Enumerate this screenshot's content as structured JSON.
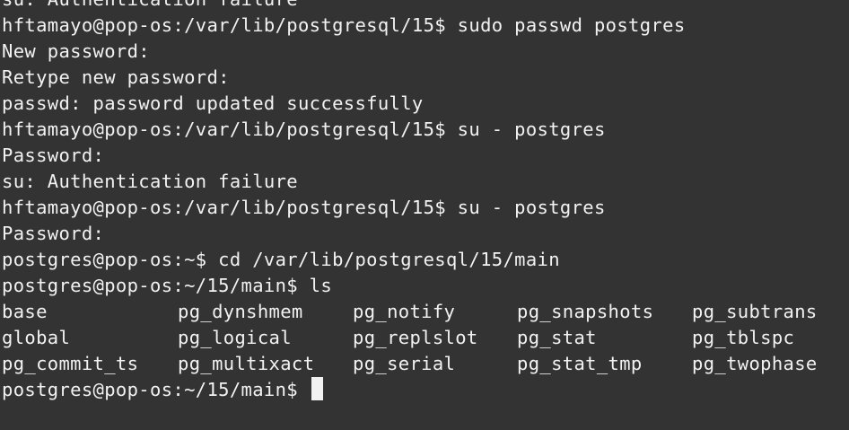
{
  "terminal": {
    "lines": [
      "su: Authentication failure",
      "hftamayo@pop-os:/var/lib/postgresql/15$ sudo passwd postgres",
      "New password:",
      "Retype new password:",
      "passwd: password updated successfully",
      "hftamayo@pop-os:/var/lib/postgresql/15$ su - postgres",
      "Password:",
      "su: Authentication failure",
      "hftamayo@pop-os:/var/lib/postgresql/15$ su - postgres",
      "Password:",
      "postgres@pop-os:~$ cd /var/lib/postgresql/15/main",
      "postgres@pop-os:~/15/main$ ls"
    ],
    "ls_rows": [
      [
        "base",
        "pg_dynshmem",
        "pg_notify",
        "pg_snapshots",
        "pg_subtrans"
      ],
      [
        "global",
        "pg_logical",
        "pg_replslot",
        "pg_stat",
        "pg_tblspc"
      ],
      [
        "pg_commit_ts",
        "pg_multixact",
        "pg_serial",
        "pg_stat_tmp",
        "pg_twophase"
      ]
    ],
    "prompt": "postgres@pop-os:~/15/main$ "
  }
}
